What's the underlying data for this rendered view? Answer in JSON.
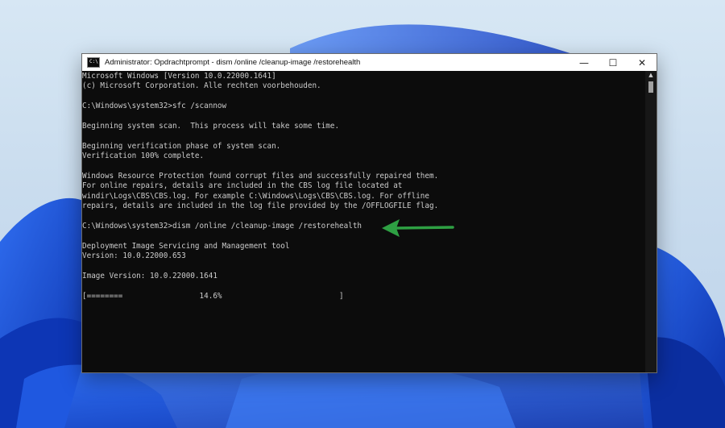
{
  "window": {
    "title": "Administrator: Opdrachtprompt - dism  /online /cleanup-image /restorehealth",
    "app_icon_text": "C:\\",
    "controls": {
      "minimize": "—",
      "maximize": "☐",
      "close": "✕"
    }
  },
  "console_lines": [
    "Microsoft Windows [Version 10.0.22000.1641]",
    "(c) Microsoft Corporation. Alle rechten voorbehouden.",
    "",
    "C:\\Windows\\system32>sfc /scannow",
    "",
    "Beginning system scan.  This process will take some time.",
    "",
    "Beginning verification phase of system scan.",
    "Verification 100% complete.",
    "",
    "Windows Resource Protection found corrupt files and successfully repaired them.",
    "For online repairs, details are included in the CBS log file located at",
    "windir\\Logs\\CBS\\CBS.log. For example C:\\Windows\\Logs\\CBS\\CBS.log. For offline",
    "repairs, details are included in the log file provided by the /OFFLOGFILE flag.",
    "",
    "C:\\Windows\\system32>dism /online /cleanup-image /restorehealth",
    "",
    "Deployment Image Servicing and Management tool",
    "Version: 10.0.22000.653",
    "",
    "Image Version: 10.0.22000.1641",
    "",
    "[========                 14.6%                          ]"
  ],
  "progress_percent": 14.6,
  "colors": {
    "console_bg": "#0c0c0c",
    "console_text": "#cccccc",
    "arrow": "#2ea043",
    "wallpaper_blue": "#1a4fd1"
  },
  "icons": [
    "cmd-app-icon",
    "minimize-icon",
    "maximize-icon",
    "close-icon",
    "scroll-up-icon",
    "green-arrow-icon"
  ]
}
